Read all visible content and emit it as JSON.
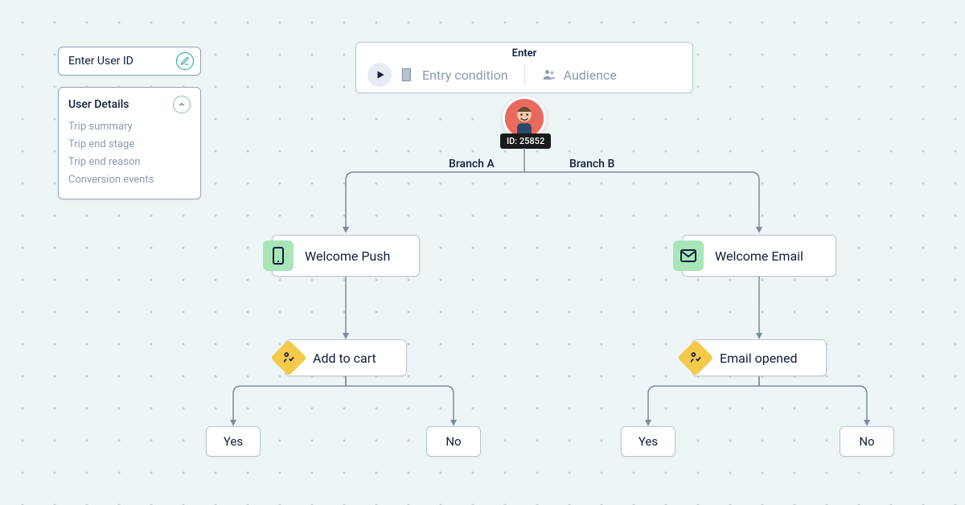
{
  "sidebar": {
    "user_id_placeholder": "Enter User ID",
    "details_title": "User Details",
    "details_items": [
      "Trip summary",
      "Trip end stage",
      "Trip end reason",
      "Conversion events"
    ]
  },
  "enter": {
    "title": "Enter",
    "entry_condition": "Entry condition",
    "audience": "Audience"
  },
  "user": {
    "id_label": "ID: 25852"
  },
  "branches": {
    "a": "Branch A",
    "b": "Branch B"
  },
  "nodes": {
    "welcome_push": "Welcome Push",
    "welcome_email": "Welcome Email",
    "add_to_cart": "Add to cart",
    "email_opened": "Email opened"
  },
  "leaves": {
    "yes": "Yes",
    "no": "No"
  }
}
